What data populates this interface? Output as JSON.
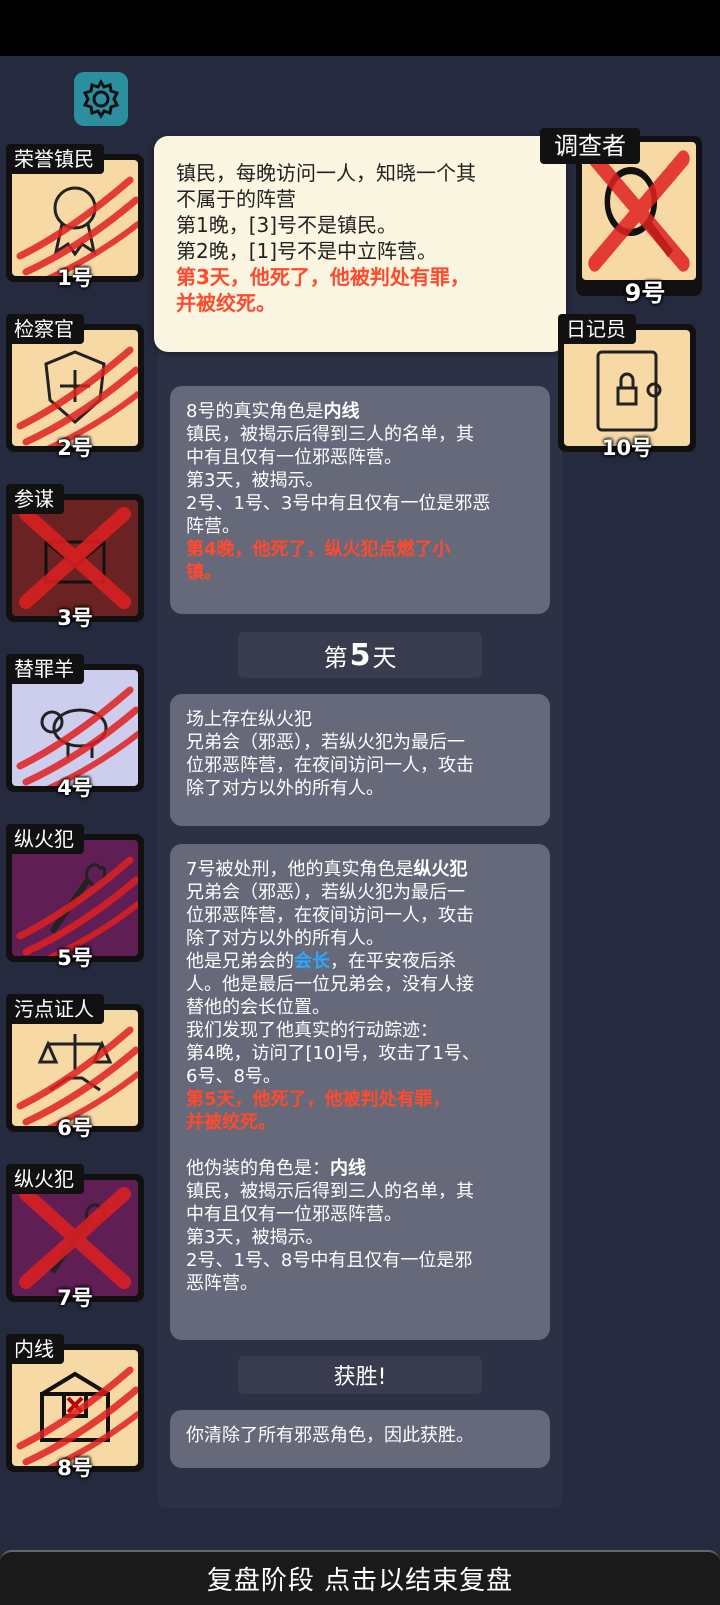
{
  "tooltip": {
    "line1": "镇民，每晚访问一人，知晓一个其",
    "line2": "不属于的阵营",
    "line3": "第1晚，[3]号不是镇民。",
    "line4": "第2晚，[1]号不是中立阵营。",
    "death1": "第3天，他死了，他被判处有罪，",
    "death2": "并被绞死。"
  },
  "messages": {
    "m1": {
      "prefix": "8号的真实角色是",
      "role": "内线",
      "l2": "镇民，被揭示后得到三人的名单，其",
      "l3": "中有且仅有一位邪恶阵营。",
      "l4": "第3天，被揭示。",
      "l5": "2号、1号、3号中有且仅有一位是邪恶",
      "l6": "阵营。",
      "d1": "第4晚，他死了，纵火犯点燃了小",
      "d2": "镇。"
    },
    "day5": {
      "pre": "第",
      "num": "5",
      "post": "天"
    },
    "m2": {
      "l1": "场上存在纵火犯",
      "l2": "兄弟会（邪恶），若纵火犯为最后一",
      "l3": "位邪恶阵营，在夜间访问一人，攻击",
      "l4": "除了对方以外的所有人。"
    },
    "m3": {
      "prefix": "7号被处刑，他的真实角色是",
      "role": "纵火犯",
      "l2": "兄弟会（邪恶），若纵火犯为最后一",
      "l3": "位邪恶阵营，在夜间访问一人，攻击",
      "l4": "除了对方以外的所有人。",
      "l5a": "他是兄弟会的",
      "l5b": "会长",
      "l5c": "，在平安夜后杀",
      "l6": "人。他是最后一位兄弟会，没有人接",
      "l7": "替他的会长位置。",
      "l8": "我们发现了他真实的行动踪迹：",
      "l9": "第4晚，访问了[10]号，攻击了1号、",
      "l10": "6号、8号。",
      "d1": "第5天，他死了，他被判处有罪，",
      "d2": "并被绞死。",
      "f1a": "他伪装的角色是：",
      "f1b": "内线",
      "f2": "镇民，被揭示后得到三人的名单，其",
      "f3": "中有且仅有一位邪恶阵营。",
      "f4": "第3天，被揭示。",
      "f5": "2号、1号、8号中有且仅有一位是邪",
      "f6": "恶阵营。"
    },
    "victory": "获胜!",
    "m4": "你清除了所有邪恶角色，因此获胜。"
  },
  "players": [
    {
      "label": "荣誉镇民",
      "num": "1号",
      "bg": "#f7d9a6",
      "icon": "medal-icon",
      "mark": "claw"
    },
    {
      "label": "检察官",
      "num": "2号",
      "bg": "#f7d9a6",
      "icon": "prosecutor-badge-icon",
      "mark": "claw"
    },
    {
      "label": "参谋",
      "num": "3号",
      "bg": "#6b2222",
      "icon": "envelope-icon",
      "mark": "cross"
    },
    {
      "label": "替罪羊",
      "num": "4号",
      "bg": "#cdcdee",
      "icon": "sheep-icon",
      "mark": "claw"
    },
    {
      "label": "纵火犯",
      "num": "5号",
      "bg": "#5f1f55",
      "icon": "torch-icon",
      "mark": "claw"
    },
    {
      "label": "污点证人",
      "num": "6号",
      "bg": "#f7d9a6",
      "icon": "scales-handshake-icon",
      "mark": "claw"
    },
    {
      "label": "纵火犯",
      "num": "7号",
      "bg": "#5f1f55",
      "icon": "torch-icon",
      "mark": "cross"
    },
    {
      "label": "内线",
      "num": "8号",
      "bg": "#f7d9a6",
      "icon": "letter-icon",
      "mark": "claw"
    },
    {
      "label": "调查者",
      "num": "9号",
      "bg": "#f7d9a6",
      "icon": "magnifier-icon",
      "mark": "cross"
    },
    {
      "label": "日记员",
      "num": "10号",
      "bg": "#f7d9a6",
      "icon": "locked-diary-icon",
      "mark": "none"
    }
  ],
  "bottom_button": "复盘阶段 点击以结束复盘"
}
